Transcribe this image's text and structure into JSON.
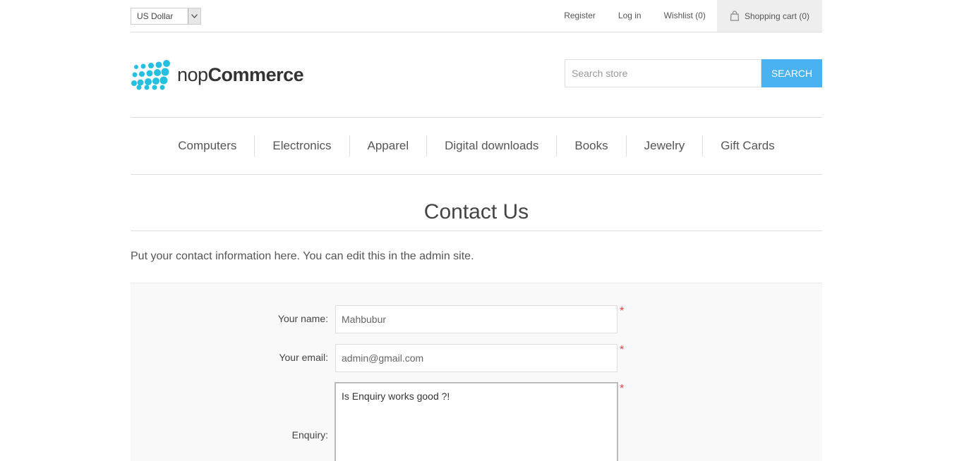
{
  "header": {
    "currency": "US Dollar",
    "links": {
      "register": "Register",
      "login": "Log in",
      "wishlist": "Wishlist (0)",
      "cart": "Shopping cart (0)"
    }
  },
  "logo": {
    "part1": "nop",
    "part2": "Commerce"
  },
  "search": {
    "placeholder": "Search store",
    "button": "SEARCH"
  },
  "nav": [
    "Computers",
    "Electronics",
    "Apparel",
    "Digital downloads",
    "Books",
    "Jewelry",
    "Gift Cards"
  ],
  "page": {
    "title": "Contact Us",
    "intro": "Put your contact information here. You can edit this in the admin site."
  },
  "form": {
    "name_label": "Your name:",
    "name_value": "Mahbubur",
    "email_label": "Your email:",
    "email_value": "admin@gmail.com",
    "enquiry_label": "Enquiry:",
    "enquiry_value": "Is Enquiry works good ?!",
    "required_mark": "*"
  },
  "colors": {
    "accent": "#4ab2f1",
    "required": "#e4434b",
    "logo_dots": "#25bfe0"
  }
}
